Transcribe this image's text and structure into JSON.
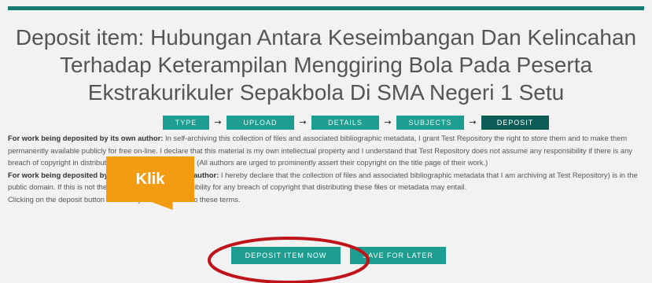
{
  "page": {
    "title": "Deposit item: Hubungan Antara Keseimbangan Dan Kelincahan Terhadap Keterampilan Menggiring Bola Pada Peserta Ekstrakurikuler Sepakbola Di SMA Negeri 1 Setu"
  },
  "workflow": {
    "steps": [
      {
        "label": "TYPE",
        "active": false
      },
      {
        "label": "UPLOAD",
        "active": false
      },
      {
        "label": "DETAILS",
        "active": false
      },
      {
        "label": "SUBJECTS",
        "active": false
      },
      {
        "label": "DEPOSIT",
        "active": true
      }
    ]
  },
  "terms": {
    "own_author_heading": "For work being deposited by its own author:",
    "own_author_text": " In self-archiving this collection of files and associated bibliographic metadata, I grant Test Repository the right to store them and to make them permanently available publicly for free on-line. I declare that this material is my own intellectual property and I understand that Test Repository does not assume any responsibility if there is any breach of copyright in distributing these files or metadata. (All authors are urged to prominently assert their copyright on the title page of their work.)",
    "other_heading": "For work being deposited by someone other than its author:",
    "other_text": " I hereby declare that the collection of files and associated bibliographic metadata that I am archiving at Test Repository) is in the public domain. If this is not the case, I accept full responsibility for any breach of copyright that distributing these files or metadata may entail.",
    "agreement_text": "Clicking on the deposit button indicates your agreement to these terms."
  },
  "actions": {
    "deposit_label": "DEPOSIT ITEM NOW",
    "save_label": "SAVE FOR LATER"
  },
  "annotation": {
    "callout_text": "Klik",
    "callout_color": "#f39c12",
    "circle_color": "#c0141b"
  },
  "colors": {
    "accent": "#1e9e90",
    "accent_dark": "#0d5c55",
    "bar": "#167a70"
  }
}
